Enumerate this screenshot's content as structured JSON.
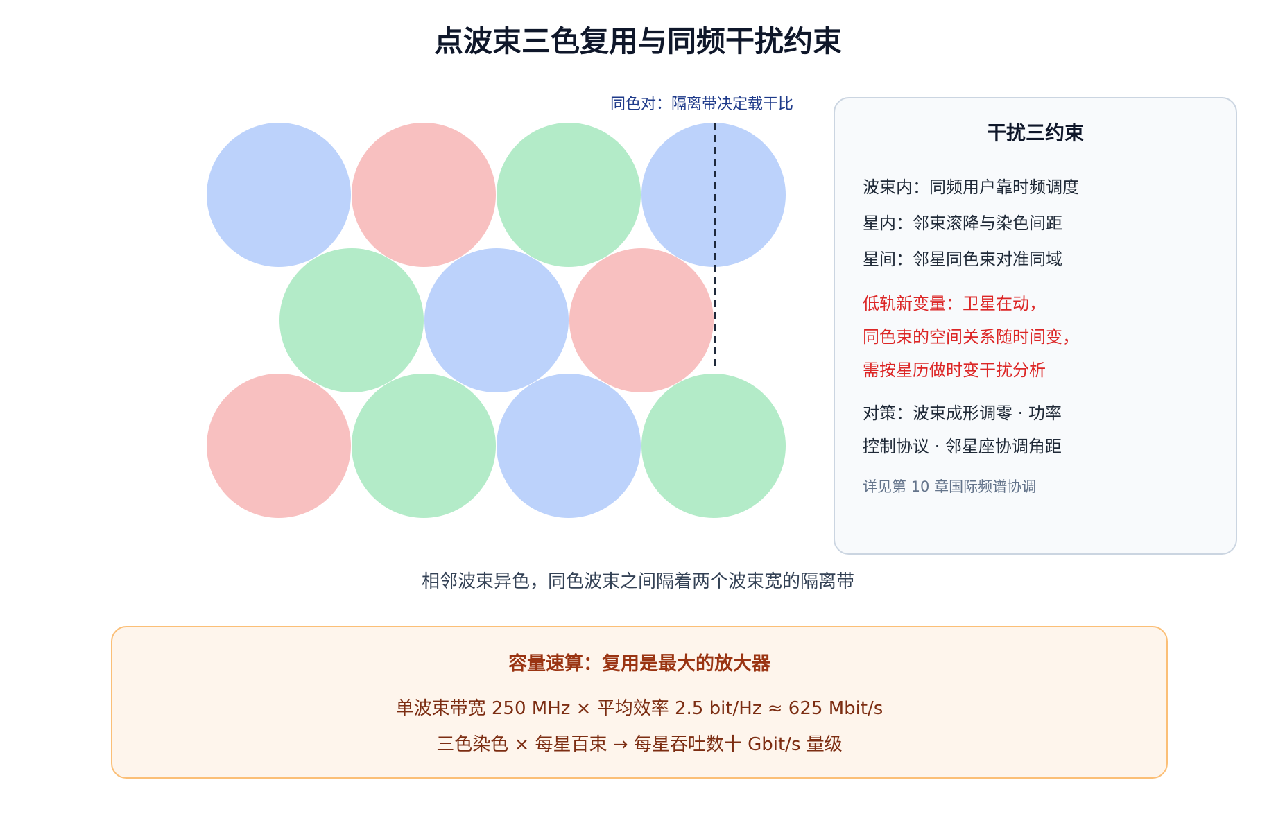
{
  "title": "点波束三色复用与同频干扰约束",
  "diagram": {
    "colors": {
      "blue": "#bcd2fb",
      "red": "#f8c0c0",
      "green": "#b3ebc8",
      "dash": "#1e293b"
    },
    "rows": [
      [
        "blue",
        "red",
        "green",
        "blue"
      ],
      [
        "green",
        "blue",
        "red"
      ],
      [
        "red",
        "green",
        "blue",
        "green"
      ]
    ],
    "same_color_pair_label": "同色对：隔离带决定载干比",
    "caption": "相邻波束异色，同色波束之间隔着两个波束宽的隔离带"
  },
  "panel": {
    "title": "干扰三约束",
    "constraints": [
      "波束内：同频用户靠时频调度",
      "星内：邻束滚降与染色间距",
      "星间：邻星同色束对准同域"
    ],
    "leo_variable": [
      "低轨新变量：卫星在动，",
      "同色束的空间关系随时间变，",
      "需按星历做时变干扰分析"
    ],
    "countermeasures": [
      "对策：波束成形调零 · 功率",
      "控制协议 · 邻星座协调角距"
    ],
    "note": "详见第 10 章国际频谱协调"
  },
  "capacity": {
    "title": "容量速算：复用是最大的放大器",
    "line1": "单波束带宽 250 MHz × 平均效率 2.5 bit/Hz ≈ 625 Mbit/s",
    "line2": "三色染色 × 每星百束 → 每星吞吐数十 Gbit/s 量级"
  }
}
